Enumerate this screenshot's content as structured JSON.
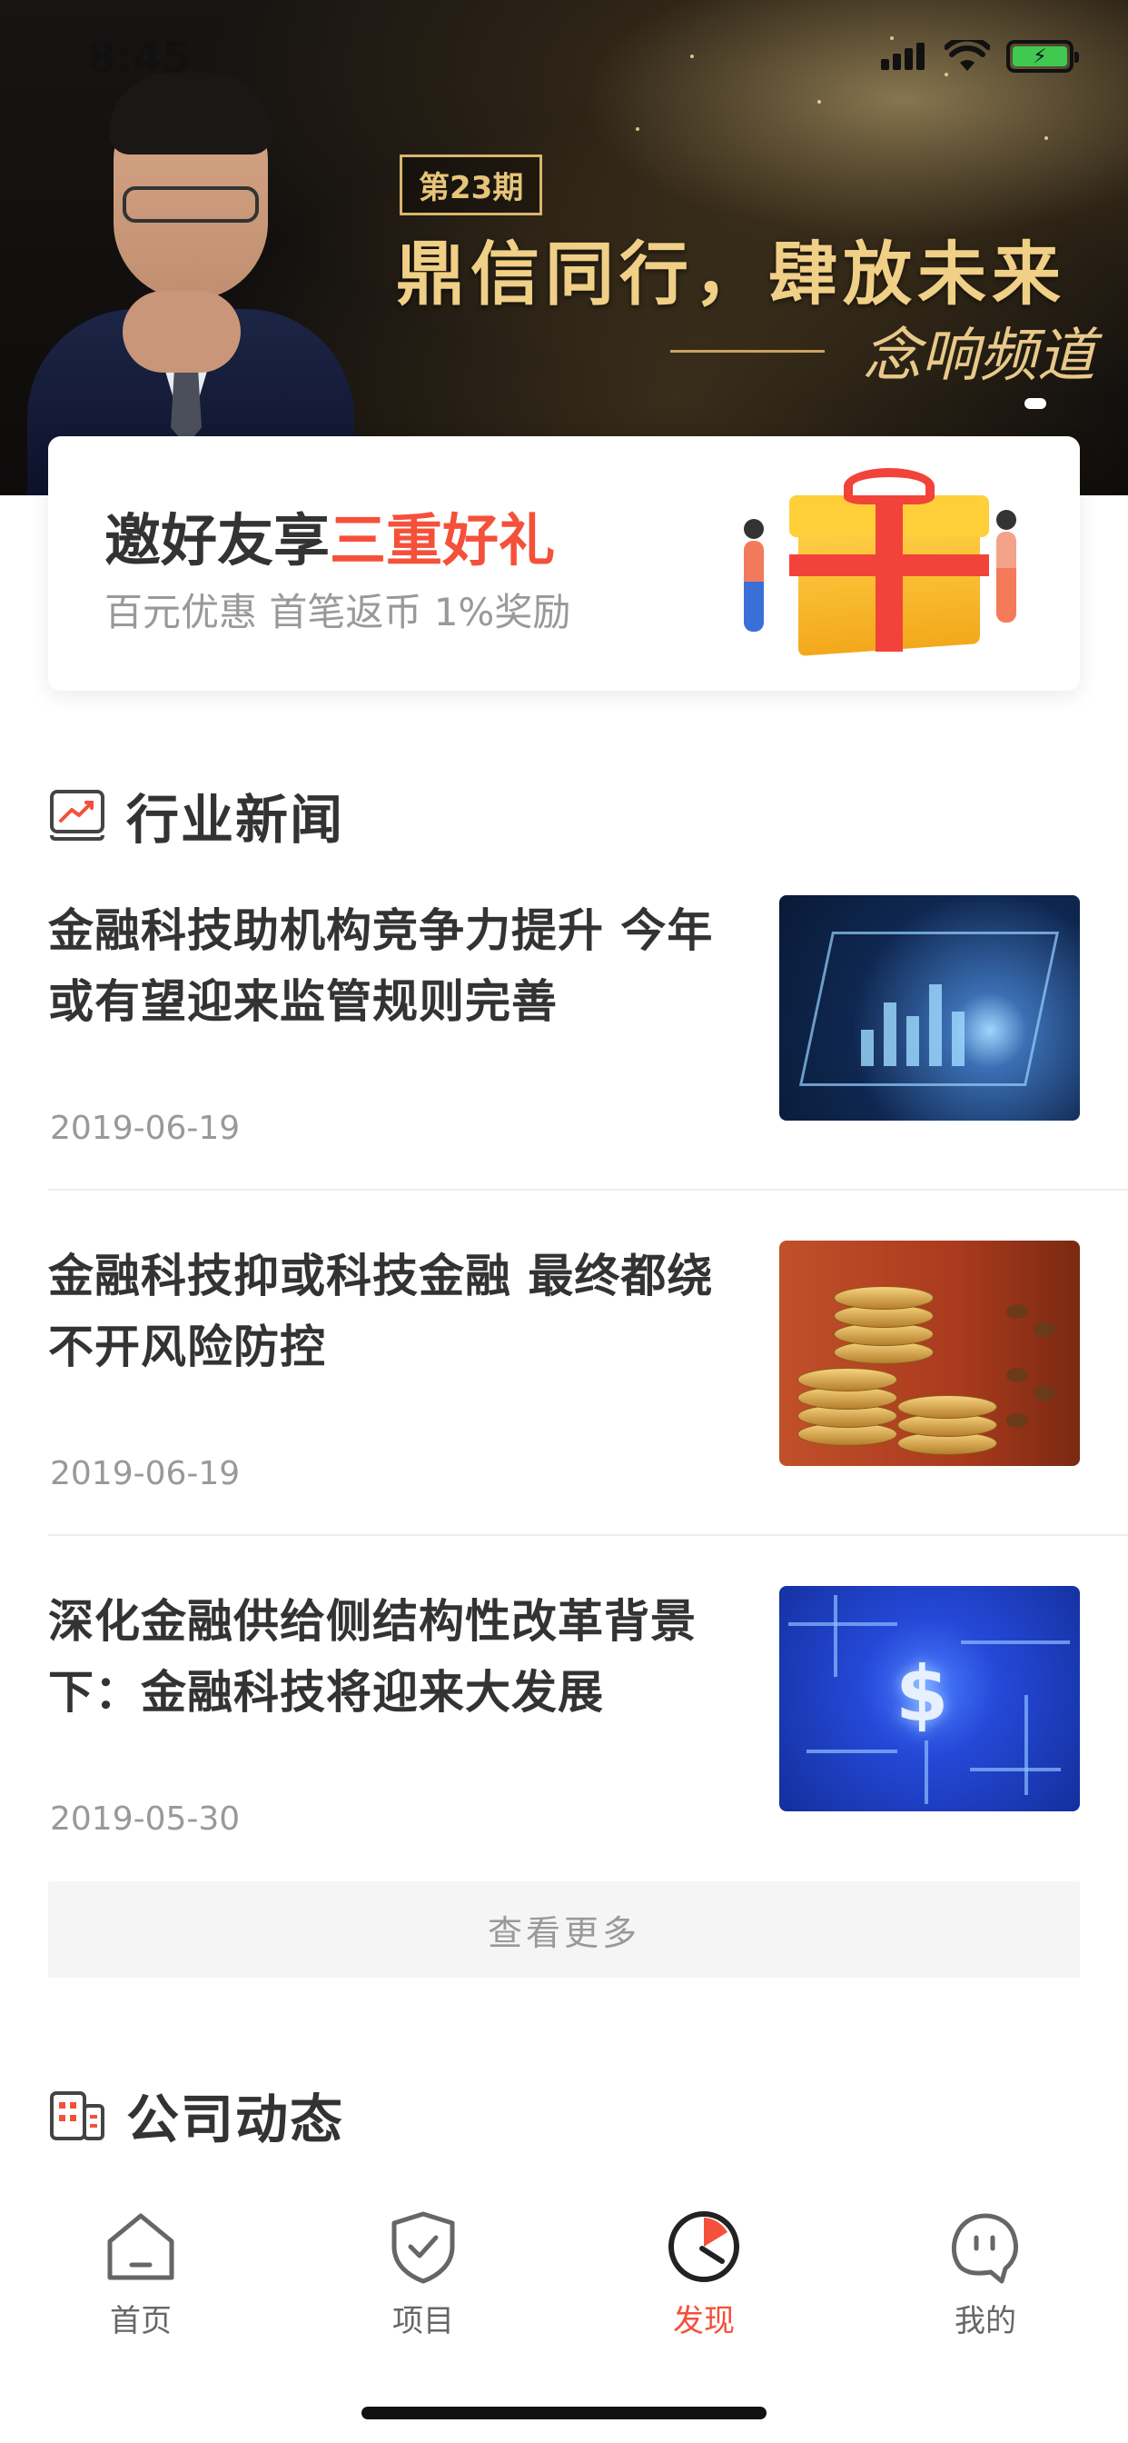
{
  "status_bar": {
    "time": "8:45"
  },
  "banner": {
    "issue": "第23期",
    "headline": "鼎信同行，肆放未来",
    "signature": "念响频道"
  },
  "invite": {
    "title_prefix": "邀好友享",
    "title_highlight": "三重好礼",
    "subtitle": "百元优惠 首笔返币 1%奖励"
  },
  "industry_news": {
    "title": "行业新闻",
    "items": [
      {
        "title": "金融科技助机构竞争力提升 今年或有望迎来监管规则完善",
        "date": "2019-06-19"
      },
      {
        "title": "金融科技抑或科技金融 最终都绕不开风险防控",
        "date": "2019-06-19"
      },
      {
        "title": "深化金融供给侧结构性改革背景下：金融科技将迎来大发展",
        "date": "2019-05-30"
      }
    ],
    "more_label": "查看更多"
  },
  "company_news": {
    "title": "公司动态"
  },
  "tabbar": {
    "items": [
      {
        "label": "首页"
      },
      {
        "label": "项目"
      },
      {
        "label": "发现"
      },
      {
        "label": "我的"
      }
    ]
  },
  "colors": {
    "accent": "#f5503a",
    "gold": "#f0cf86",
    "text": "#333333",
    "muted": "#999999"
  }
}
